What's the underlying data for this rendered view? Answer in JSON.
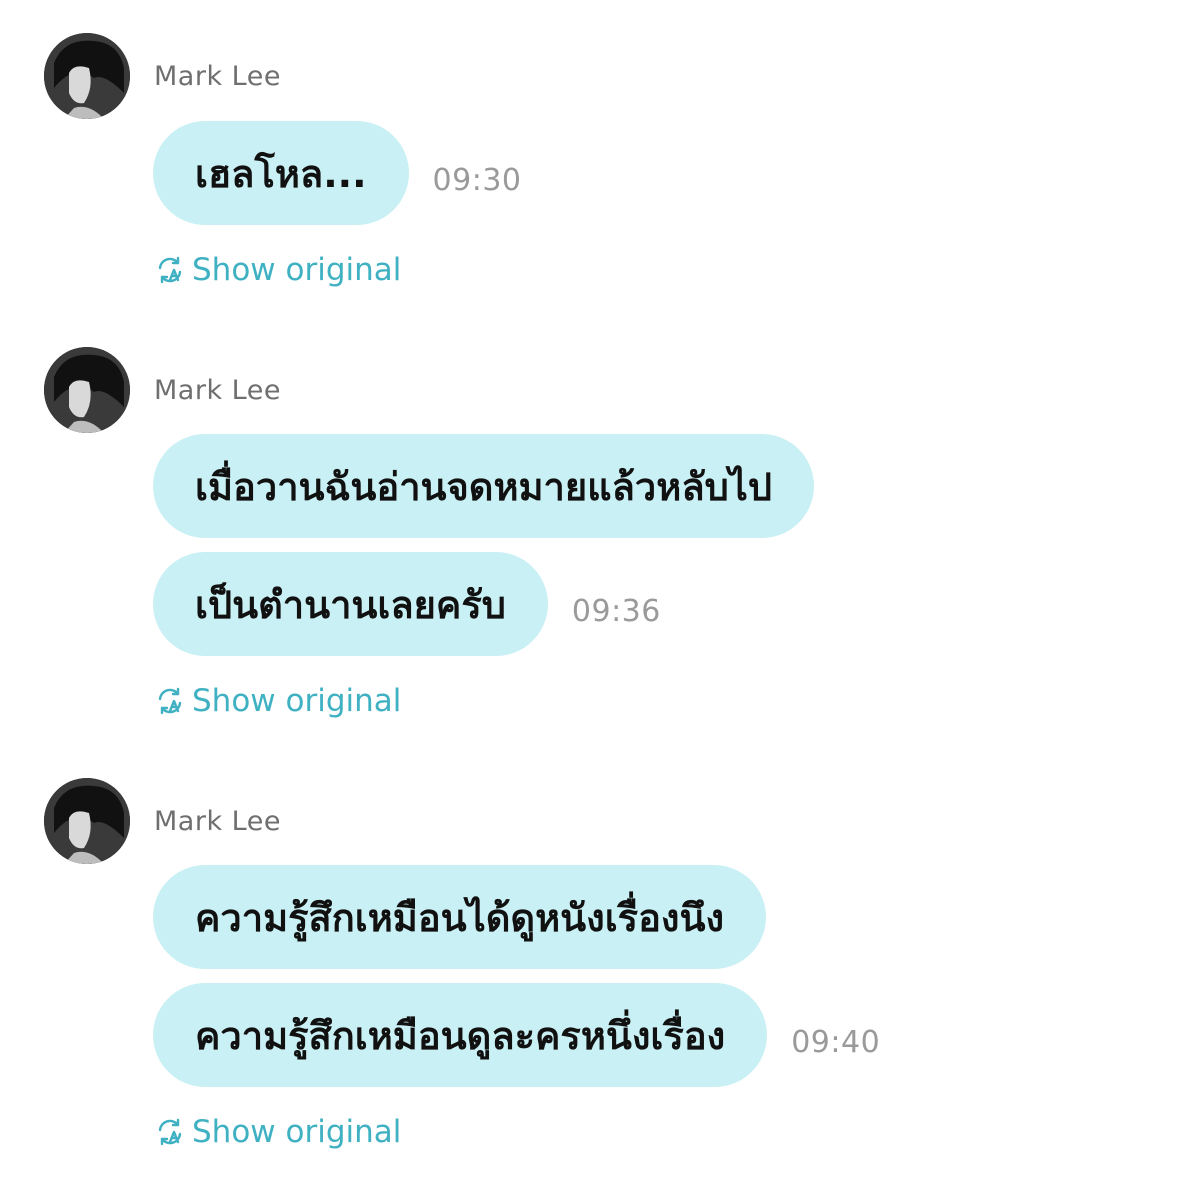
{
  "colors": {
    "bubble": "#c9f0f4",
    "accent": "#3fb1c2",
    "timestamp": "#9a9a9a",
    "sender": "#6f6f6f"
  },
  "messages": [
    {
      "sender": "Mark Lee",
      "bubbles": [
        "เฮลโหล..."
      ],
      "time": "09:30",
      "action_label": "Show original",
      "action_icon": "translate-icon"
    },
    {
      "sender": "Mark Lee",
      "bubbles": [
        "เมื่อวานฉันอ่านจดหมายแล้วหลับไป",
        "เป็นตำนานเลยครับ"
      ],
      "time": "09:36",
      "action_label": "Show original",
      "action_icon": "translate-icon"
    },
    {
      "sender": "Mark Lee",
      "bubbles": [
        "ความรู้สึกเหมือนได้ดูหนังเรื่องนึง",
        "ความรู้สึกเหมือนดูละครหนึ่งเรื่อง"
      ],
      "time": "09:40",
      "action_label": "Show original",
      "action_icon": "translate-icon"
    }
  ]
}
